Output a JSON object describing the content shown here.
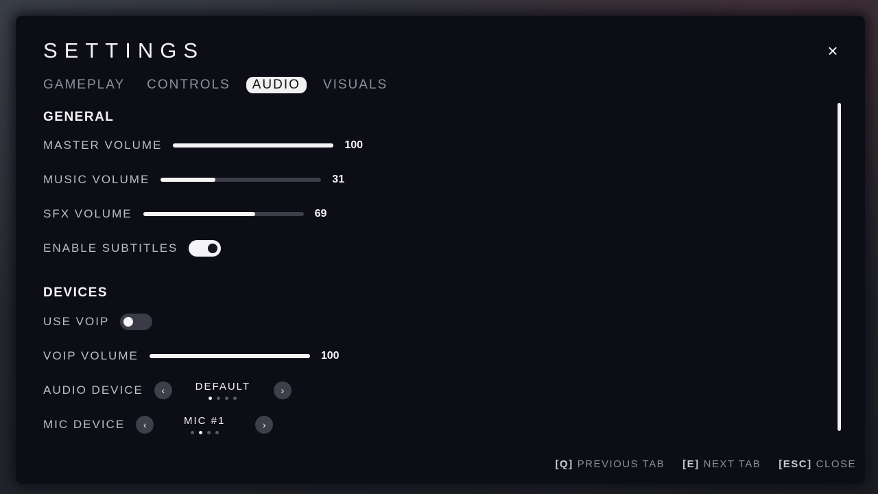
{
  "title": "SETTINGS",
  "close_symbol": "×",
  "tabs": [
    {
      "label": "GAMEPLAY",
      "active": false
    },
    {
      "label": "CONTROLS",
      "active": false
    },
    {
      "label": "AUDIO",
      "active": true
    },
    {
      "label": "VISUALS",
      "active": false
    }
  ],
  "general": {
    "heading": "GENERAL",
    "master_volume": {
      "label": "MASTER VOLUME",
      "value": "100",
      "fraction": 1.0
    },
    "music_volume": {
      "label": "MUSIC VOLUME",
      "value": "31",
      "fraction": 0.34
    },
    "sfx_volume": {
      "label": "SFX VOLUME",
      "value": "69",
      "fraction": 0.7
    },
    "subtitles": {
      "label": "ENABLE SUBTITLES",
      "on": true
    }
  },
  "devices": {
    "heading": "DEVICES",
    "use_voip": {
      "label": "USE VOIP",
      "on": false
    },
    "voip_volume": {
      "label": "VOIP VOLUME",
      "value": "100",
      "fraction": 1.0
    },
    "audio_device": {
      "label": "AUDIO DEVICE",
      "value": "DEFAULT",
      "dot_count": 4,
      "active_dot": 0
    },
    "mic_device": {
      "label": "MIC DEVICE",
      "value": "MIC #1",
      "dot_count": 4,
      "active_dot": 1
    }
  },
  "arrows": {
    "prev": "‹",
    "next": "›"
  },
  "hints": [
    {
      "key": "[Q]",
      "label": "PREVIOUS TAB"
    },
    {
      "key": "[E]",
      "label": "NEXT TAB"
    },
    {
      "key": "[ESC]",
      "label": "CLOSE"
    }
  ],
  "colors": {
    "panel": "#0d0d16",
    "accent": "#f4f4f6",
    "track": "#3c3d48"
  }
}
